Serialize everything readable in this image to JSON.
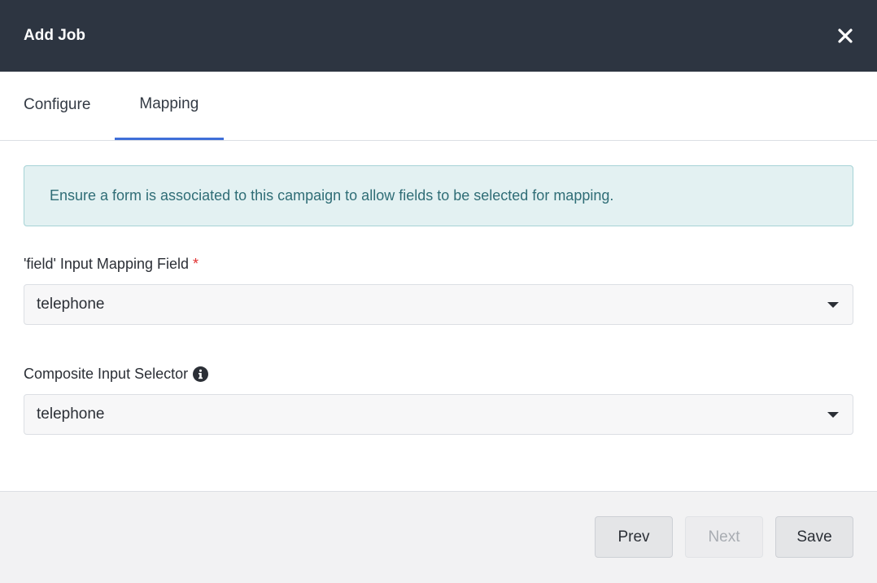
{
  "modal": {
    "title": "Add Job"
  },
  "tabs": [
    {
      "label": "Configure",
      "active": false
    },
    {
      "label": "Mapping",
      "active": true
    }
  ],
  "alert": {
    "message": "Ensure a form is associated to this campaign to allow fields to be selected for mapping."
  },
  "fields": {
    "input_mapping": {
      "label": "'field' Input Mapping Field",
      "required_marker": "*",
      "value": "telephone"
    },
    "composite_selector": {
      "label": "Composite Input Selector",
      "info_icon": "info-icon",
      "value": "telephone"
    }
  },
  "footer": {
    "prev_label": "Prev",
    "next_label": "Next",
    "save_label": "Save"
  },
  "colors": {
    "header_bg": "#2d3541",
    "tab_active_underline": "#3f6fd8",
    "alert_bg": "#e3f1f2",
    "alert_text": "#2f6d76",
    "required": "#e03131"
  }
}
